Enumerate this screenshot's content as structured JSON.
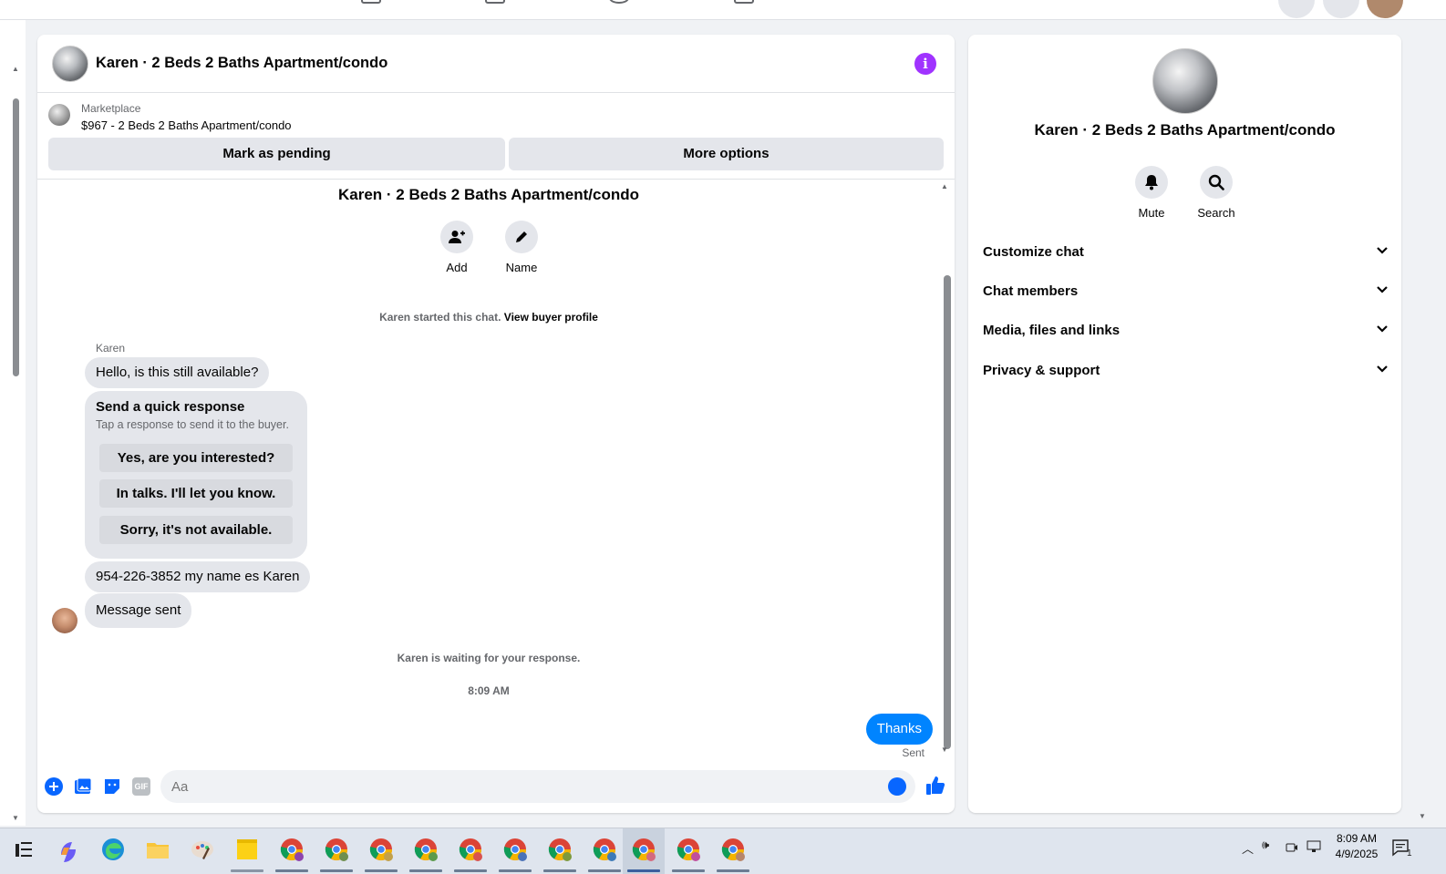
{
  "chat": {
    "title": "Karen · 2 Beds 2 Baths Apartment/condo",
    "info_glyph": "i"
  },
  "marketplace": {
    "label": "Marketplace",
    "listing": "$967 - 2 Beds 2 Baths Apartment/condo",
    "mark_pending_label": "Mark as pending",
    "more_options_label": "More options"
  },
  "conversation": {
    "title": "Karen · 2 Beds 2 Baths Apartment/condo",
    "add_label": "Add",
    "name_label": "Name",
    "started_text": "Karen started this chat.",
    "view_profile_link": "View buyer profile",
    "sender_name": "Karen",
    "messages": [
      "Hello, is this still available?",
      "954-226-3852 my name es Karen",
      "Message sent"
    ],
    "quick_response": {
      "title": "Send a quick response",
      "subtitle": "Tap a response to send it to the buyer.",
      "options": [
        "Yes, are you interested?",
        "In talks. I'll let you know.",
        "Sorry, it's not available."
      ]
    },
    "waiting_text": "Karen is waiting for your response.",
    "timestamp": "8:09 AM",
    "sent_message": "Thanks",
    "sent_status": "Sent"
  },
  "composer": {
    "placeholder": "Aa",
    "gif_label": "GIF",
    "accent": "#0866ff"
  },
  "info_panel": {
    "title": "Karen · 2 Beds 2 Baths Apartment/condo",
    "mute_label": "Mute",
    "search_label": "Search",
    "sections": [
      "Customize chat",
      "Chat members",
      "Media, files and links",
      "Privacy & support"
    ]
  },
  "taskbar": {
    "time": "8:09 AM",
    "date": "4/9/2025",
    "notification_count": "1"
  }
}
